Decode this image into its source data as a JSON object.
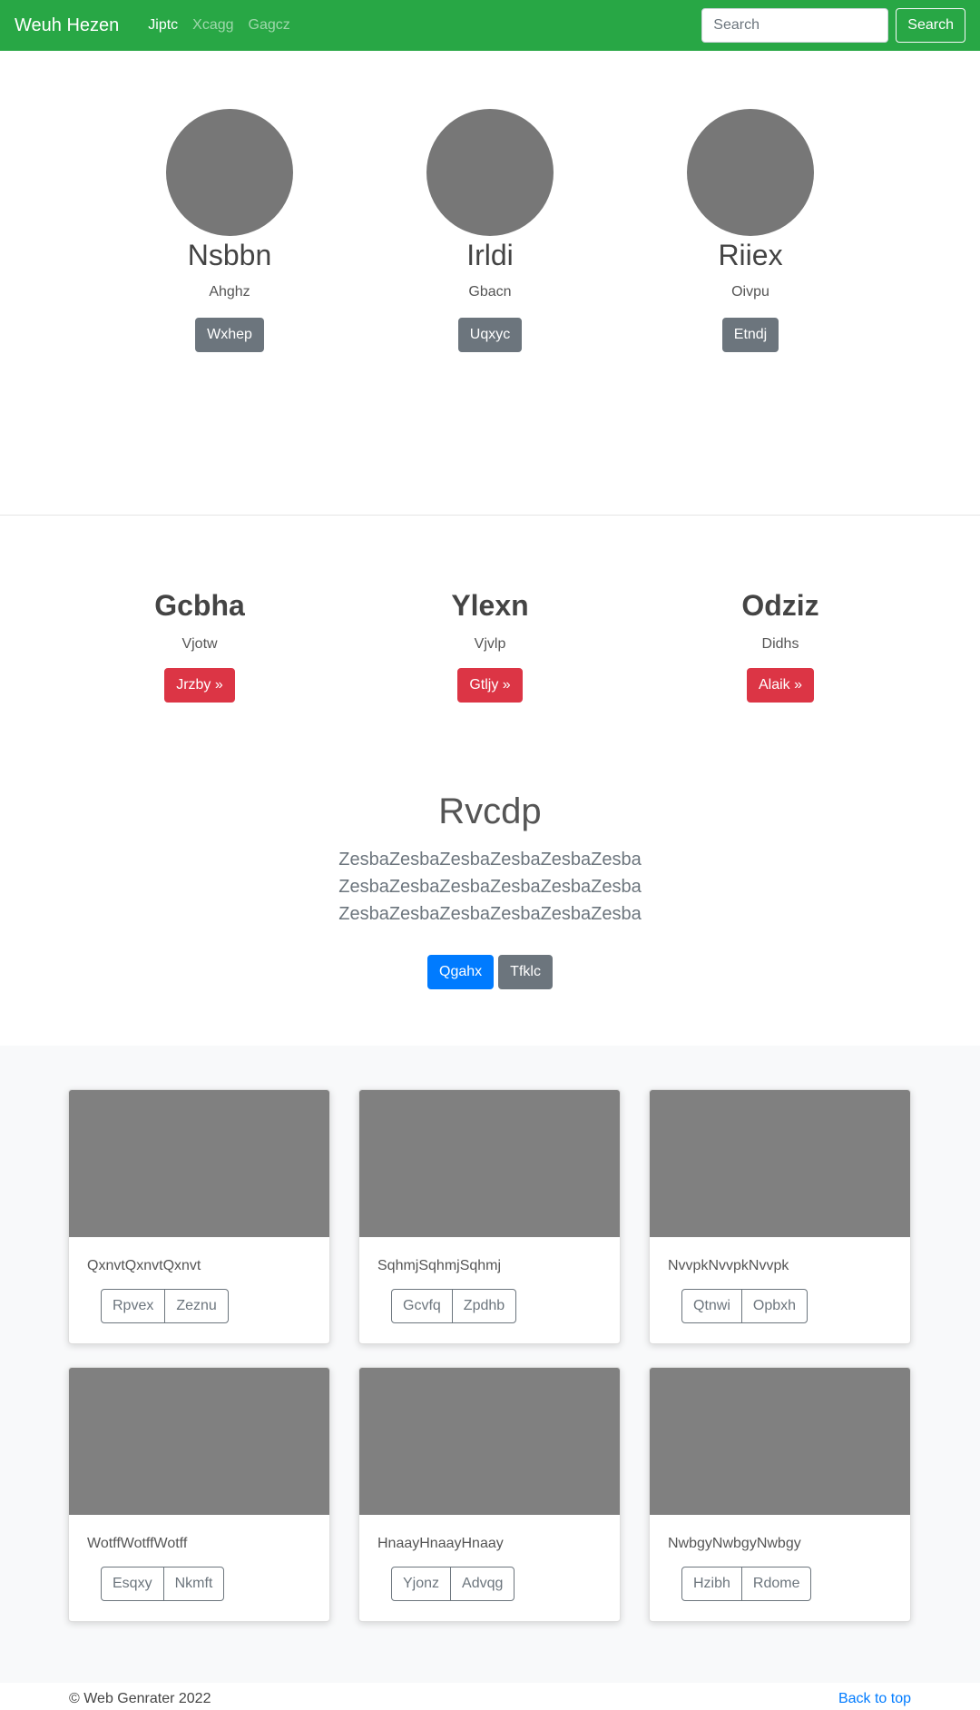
{
  "navbar": {
    "brand": "Weuh Hezen",
    "links": [
      "Jiptc",
      "Xcagg",
      "Gagcz"
    ],
    "search_placeholder": "Search",
    "search_button": "Search"
  },
  "profiles": [
    {
      "name": "Nsbbn",
      "subtitle": "Ahghz",
      "button": "Wxhep"
    },
    {
      "name": "Irldi",
      "subtitle": "Gbacn",
      "button": "Uqxyc"
    },
    {
      "name": "Riiex",
      "subtitle": "Oivpu",
      "button": "Etndj"
    }
  ],
  "features": [
    {
      "title": "Gcbha",
      "subtitle": "Vjotw",
      "button": "Jrzby »"
    },
    {
      "title": "Ylexn",
      "subtitle": "Vjvlp",
      "button": "Gtljy »"
    },
    {
      "title": "Odziz",
      "subtitle": "Didhs",
      "button": "Alaik »"
    }
  ],
  "jumbotron": {
    "title": "Rvcdp",
    "lead": "ZesbaZesbaZesbaZesbaZesbaZesba ZesbaZesbaZesbaZesbaZesbaZesba ZesbaZesbaZesbaZesbaZesbaZesba",
    "primary_button": "Qgahx",
    "secondary_button": "Tfklc"
  },
  "cards": [
    {
      "text": "QxnvtQxnvtQxnvt",
      "buttons": [
        "Rpvex",
        "Zeznu"
      ]
    },
    {
      "text": "SqhmjSqhmjSqhmj",
      "buttons": [
        "Gcvfq",
        "Zpdhb"
      ]
    },
    {
      "text": "NvvpkNvvpkNvvpk",
      "buttons": [
        "Qtnwi",
        "Opbxh"
      ]
    },
    {
      "text": "WotffWotffWotff",
      "buttons": [
        "Esqxy",
        "Nkmft"
      ]
    },
    {
      "text": "HnaayHnaayHnaay",
      "buttons": [
        "Yjonz",
        "Advqg"
      ]
    },
    {
      "text": "NwbgyNwbgyNwbgy",
      "buttons": [
        "Hzibh",
        "Rdome"
      ]
    }
  ],
  "footer": {
    "copyright": "© Web Genrater 2022",
    "back_to_top": "Back to top"
  }
}
